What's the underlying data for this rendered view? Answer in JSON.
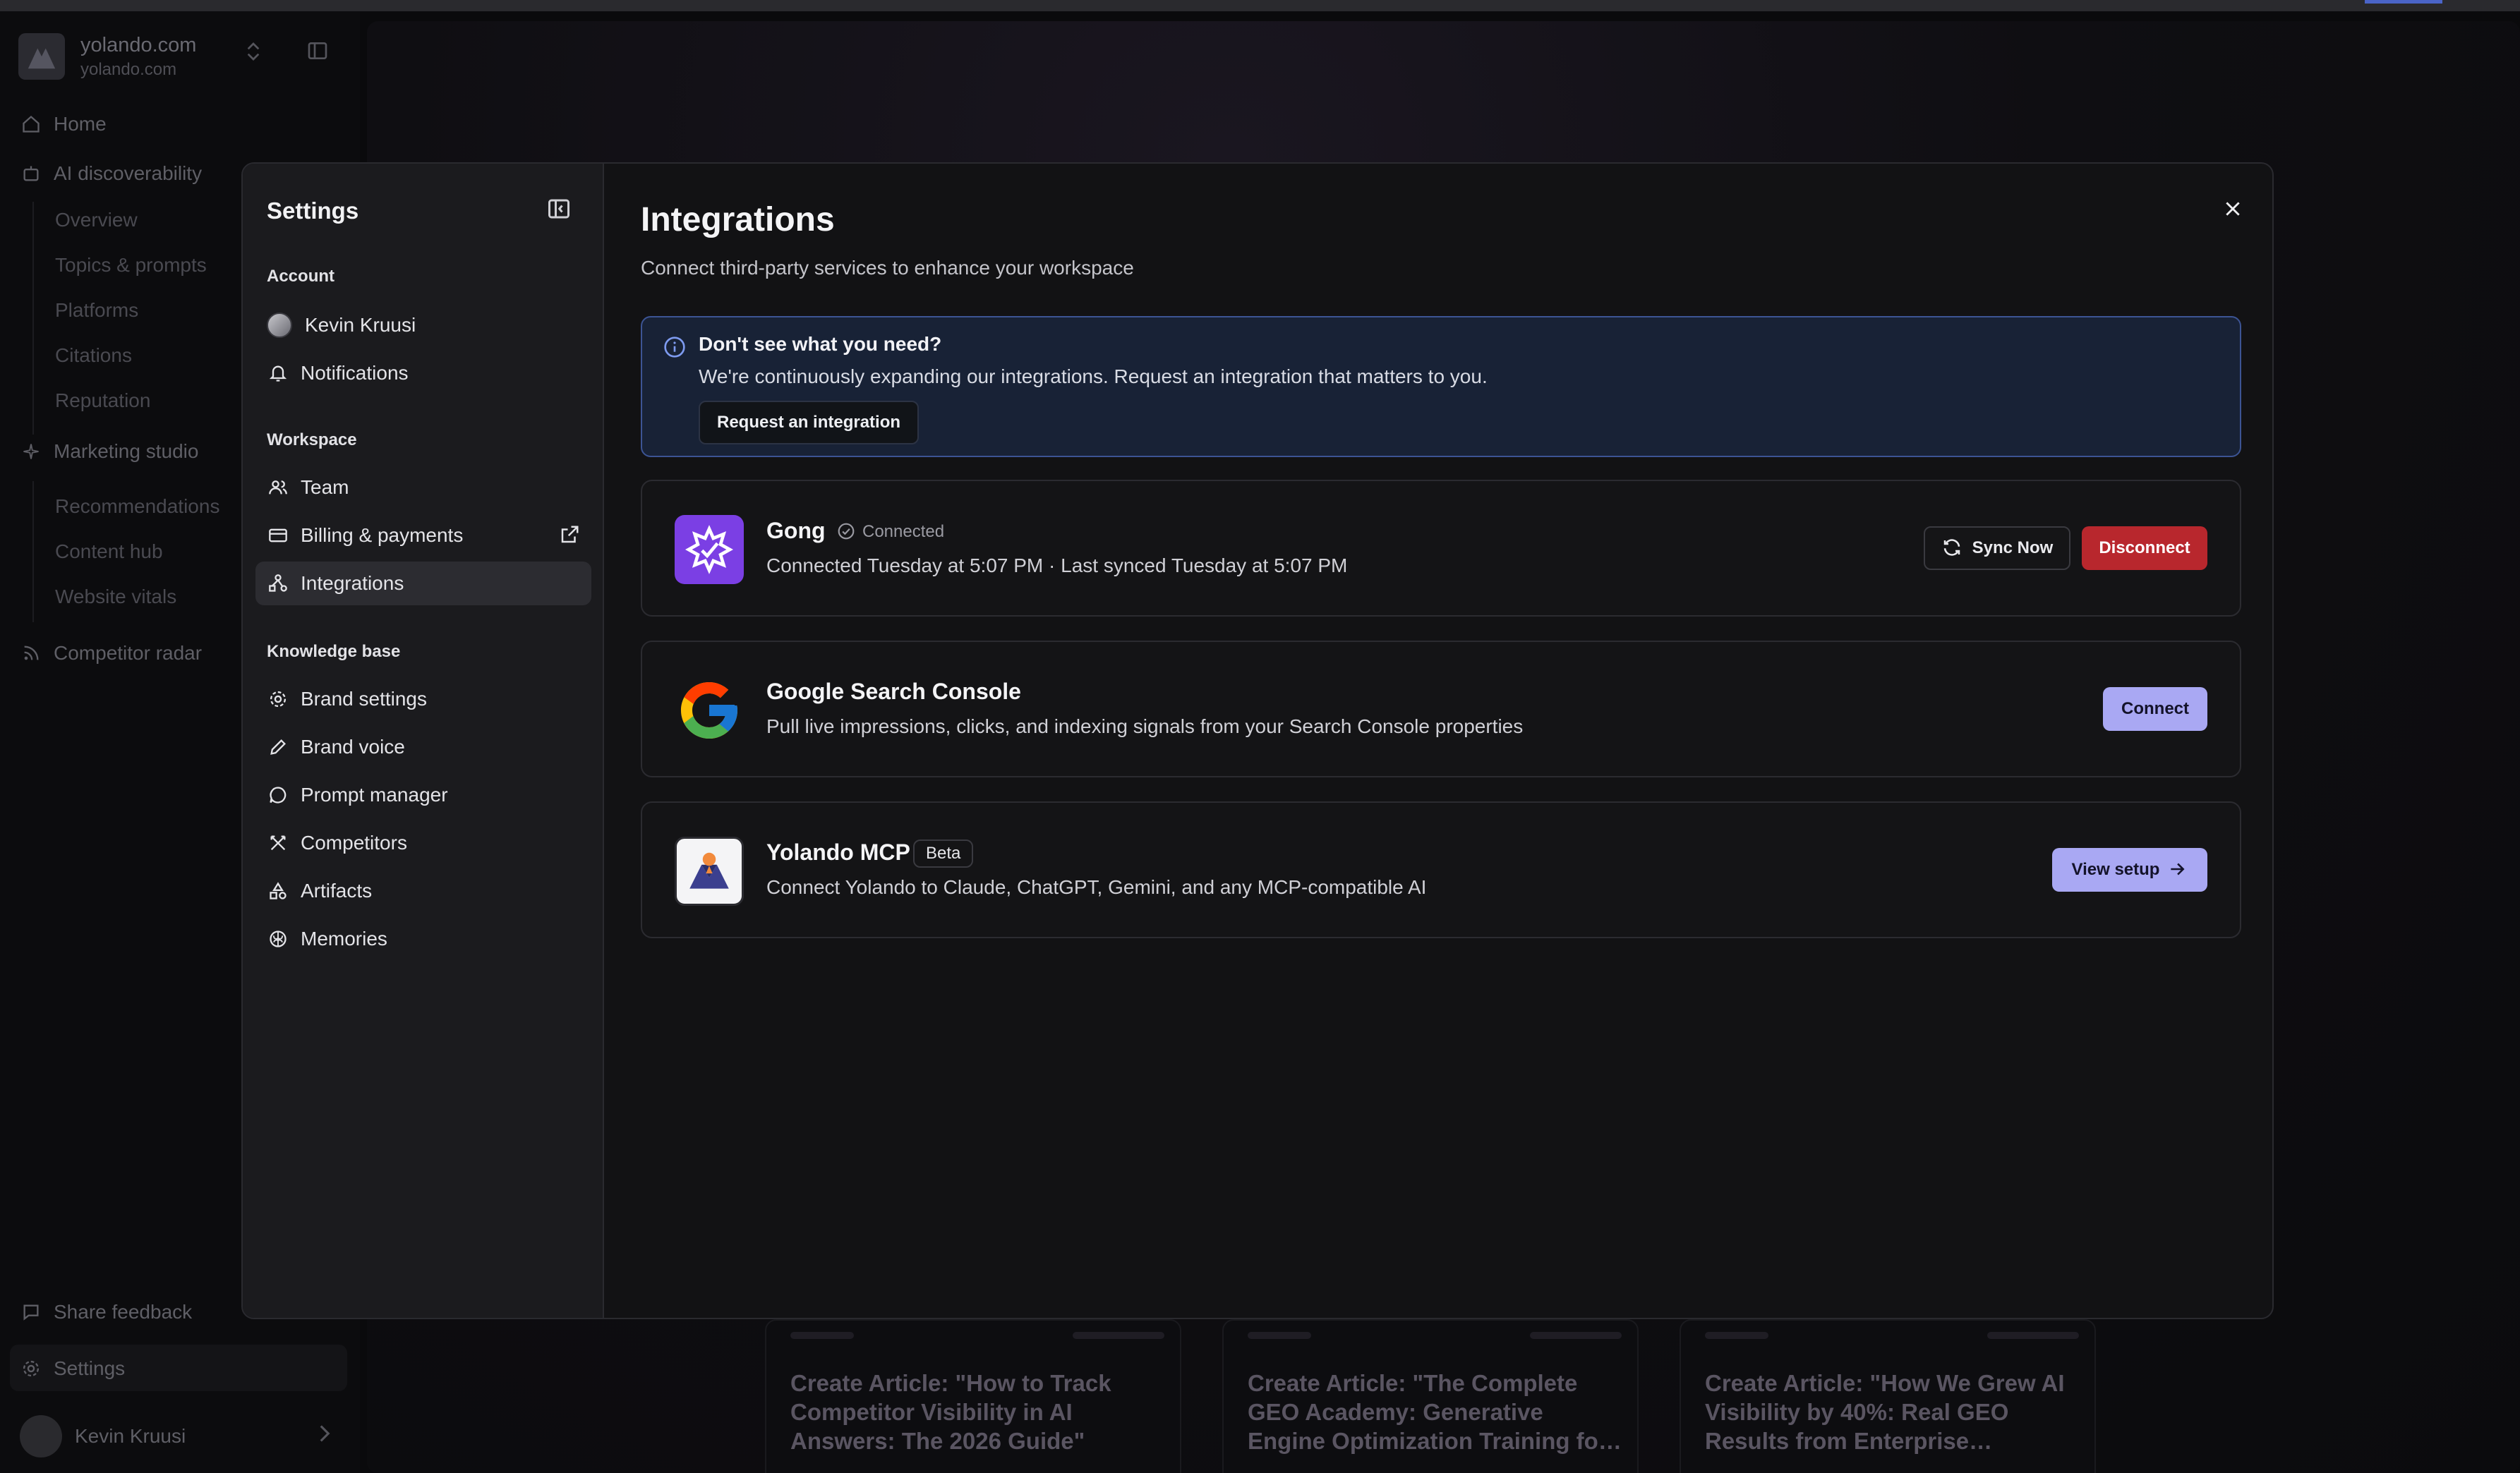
{
  "workspace": {
    "name": "yolando.com",
    "domain": "yolando.com"
  },
  "app_nav": {
    "home": "Home",
    "ai_discoverability": "AI discoverability",
    "ai_sub": [
      "Overview",
      "Topics & prompts",
      "Platforms",
      "Citations",
      "Reputation"
    ],
    "marketing_studio": "Marketing studio",
    "marketing_sub": [
      "Recommendations",
      "Content hub",
      "Website vitals"
    ],
    "competitor_radar": "Competitor radar",
    "share_feedback": "Share feedback",
    "settings": "Settings",
    "user_name": "Kevin Kruusi"
  },
  "background_cards": [
    {
      "title": "Create Article: \"How to Track Competitor Visibility in AI Answers: The 2026 Guide\""
    },
    {
      "title": "Create Article: \"The Complete GEO Academy: Generative Engine Optimization Training fo…"
    },
    {
      "title": "Create Article: \"How We Grew AI Visibility by 40%: Real GEO Results from Enterprise…"
    }
  ],
  "settings": {
    "title": "Settings",
    "sections": {
      "account": "Account",
      "workspace": "Workspace",
      "knowledge_base": "Knowledge base"
    },
    "items": {
      "profile": "Kevin Kruusi",
      "notifications": "Notifications",
      "team": "Team",
      "billing": "Billing & payments",
      "integrations": "Integrations",
      "brand_settings": "Brand settings",
      "brand_voice": "Brand voice",
      "prompt_manager": "Prompt manager",
      "competitors": "Competitors",
      "artifacts": "Artifacts",
      "memories": "Memories"
    }
  },
  "integrations": {
    "title": "Integrations",
    "subtitle": "Connect third-party services to enhance your workspace",
    "info": {
      "title": "Don't see what you need?",
      "text": "We're continuously expanding our integrations. Request an integration that matters to you.",
      "button": "Request an integration"
    },
    "gong": {
      "name": "Gong",
      "status": "Connected",
      "desc": "Connected Tuesday at 5:07 PM · Last synced Tuesday at 5:07 PM",
      "sync_label": "Sync Now",
      "disconnect_label": "Disconnect"
    },
    "gsc": {
      "name": "Google Search Console",
      "desc": "Pull live impressions, clicks, and indexing signals from your Search Console properties",
      "connect_label": "Connect"
    },
    "mcp": {
      "name": "Yolando MCP",
      "badge": "Beta",
      "desc": "Connect Yolando to Claude, ChatGPT, Gemini, and any MCP-compatible AI",
      "setup_label": "View setup"
    }
  },
  "colors": {
    "accent": "#a9a8f3",
    "danger": "#b8272d",
    "info_bg": "#182236",
    "info_border": "#3c5494",
    "gong": "#7b3fe4"
  }
}
